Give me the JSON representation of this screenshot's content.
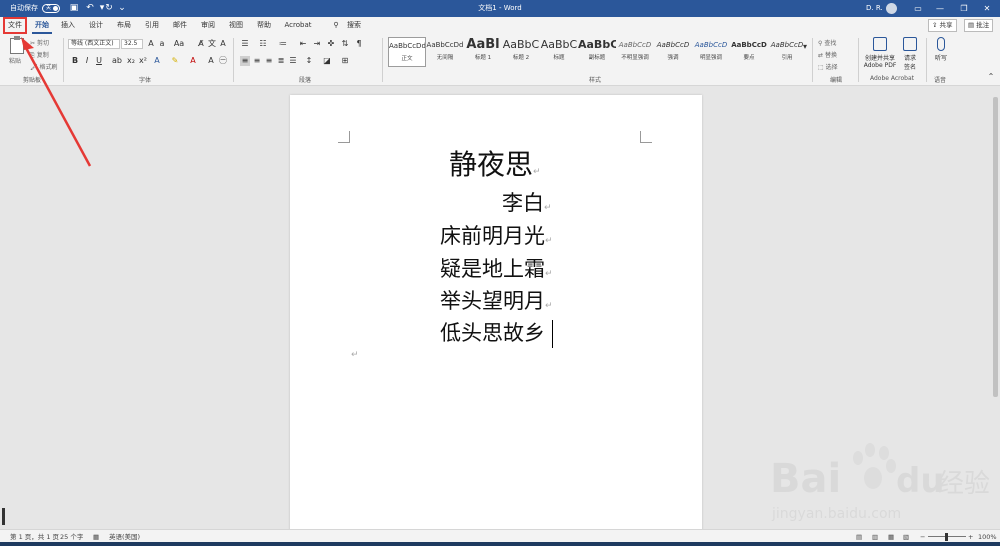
{
  "titlebar": {
    "autosave_label": "自动保存",
    "autosave_state": "关",
    "doc_title": "文档1 - Word",
    "user": "D. R."
  },
  "tabs": [
    {
      "label": "文件",
      "state": "highlighted-red"
    },
    {
      "label": "开始",
      "state": "active"
    },
    {
      "label": "插入"
    },
    {
      "label": "设计"
    },
    {
      "label": "布局"
    },
    {
      "label": "引用"
    },
    {
      "label": "邮件"
    },
    {
      "label": "审阅"
    },
    {
      "label": "视图"
    },
    {
      "label": "帮助"
    },
    {
      "label": "Acrobat"
    },
    {
      "label": "搜索"
    }
  ],
  "share_label": "共享",
  "comment_label": "批注",
  "ribbon": {
    "clipboard": {
      "paste": "粘贴",
      "cut": "剪切",
      "copy": "复制",
      "format_painter": "格式刷",
      "group": "剪贴板"
    },
    "font": {
      "name": "等线 (西文正文)",
      "size": "32.5",
      "group": "字体"
    },
    "paragraph": {
      "group": "段落"
    },
    "styles": {
      "group": "样式",
      "items": [
        {
          "sample": "AaBbCcDd",
          "name": "正文",
          "selected": true
        },
        {
          "sample": "AaBbCcDd",
          "name": "无间隔"
        },
        {
          "sample": "AaBl",
          "name": "标题 1"
        },
        {
          "sample": "AaBbC",
          "name": "标题 2"
        },
        {
          "sample": "AaBbC",
          "name": "标题"
        },
        {
          "sample": "AaBbC",
          "name": "副标题"
        },
        {
          "sample": "AaBbCcD",
          "name": "不明显强调"
        },
        {
          "sample": "AaBbCcD",
          "name": "强调"
        },
        {
          "sample": "AaBbCcD",
          "name": "明显强调"
        },
        {
          "sample": "AaBbCcD",
          "name": "要点"
        },
        {
          "sample": "AaBbCcD",
          "name": "引用"
        }
      ]
    },
    "editing": {
      "find": "查找",
      "replace": "替换",
      "select": "选择",
      "group": "编辑"
    },
    "acrobat": {
      "create_share": "创建并共享",
      "create_share2": "Adobe PDF",
      "request_sign": "请求",
      "request_sign2": "签名",
      "group": "Adobe Acrobat"
    },
    "voice": {
      "dictate": "听写",
      "group": "语音"
    }
  },
  "document": {
    "title": "静夜思",
    "author": "李白",
    "lines": [
      "床前明月光",
      "疑是地上霜",
      "举头望明月",
      "低头思故乡"
    ],
    "paragraph_mark": "↵"
  },
  "statusbar": {
    "page": "第 1 页，共 1 页",
    "words": "25 个字",
    "language": "英语(美国)",
    "zoom": "100%"
  },
  "watermark": {
    "brand": "Bai",
    "brand2": "du",
    "cn": "经验",
    "url": "jingyan.baidu.com"
  }
}
